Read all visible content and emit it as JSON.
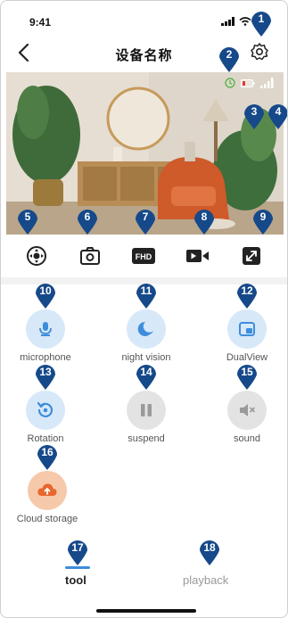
{
  "status_bar": {
    "time": "9:41"
  },
  "nav": {
    "title": "设备名称",
    "back_icon": "chevron-left-icon",
    "settings_icon": "gear-icon"
  },
  "controls": [
    {
      "name": "ptz-control",
      "icon": "ptz-icon"
    },
    {
      "name": "snapshot",
      "icon": "camera-icon"
    },
    {
      "name": "resolution",
      "icon": "fhd-icon",
      "label": "FHD"
    },
    {
      "name": "record",
      "icon": "video-record-icon"
    },
    {
      "name": "fullscreen",
      "icon": "expand-icon"
    }
  ],
  "functions": [
    {
      "label": "microphone",
      "icon": "microphone-icon"
    },
    {
      "label": "night vision",
      "icon": "moon-star-icon"
    },
    {
      "label": "DualView",
      "icon": "dual-view-icon"
    },
    {
      "label": "Rotation",
      "icon": "rotate-icon"
    },
    {
      "label": "suspend",
      "icon": "pause-icon"
    },
    {
      "label": "sound",
      "icon": "mute-icon"
    },
    {
      "label": "Cloud storage",
      "icon": "cloud-upload-icon"
    }
  ],
  "tabs": {
    "tool": "tool",
    "playback": "playback"
  },
  "callouts": [
    "1",
    "2",
    "3",
    "4",
    "5",
    "6",
    "7",
    "8",
    "9",
    "10",
    "11",
    "12",
    "13",
    "14",
    "15",
    "16",
    "17",
    "18"
  ],
  "colors": {
    "callout": "#16498a",
    "accent": "#3d8ddb",
    "active_fill": "#d7e8f9",
    "inactive_fill": "#e3e3e3",
    "cloud_fill": "#f6c9ab",
    "cloud_icon": "#e8672d"
  }
}
